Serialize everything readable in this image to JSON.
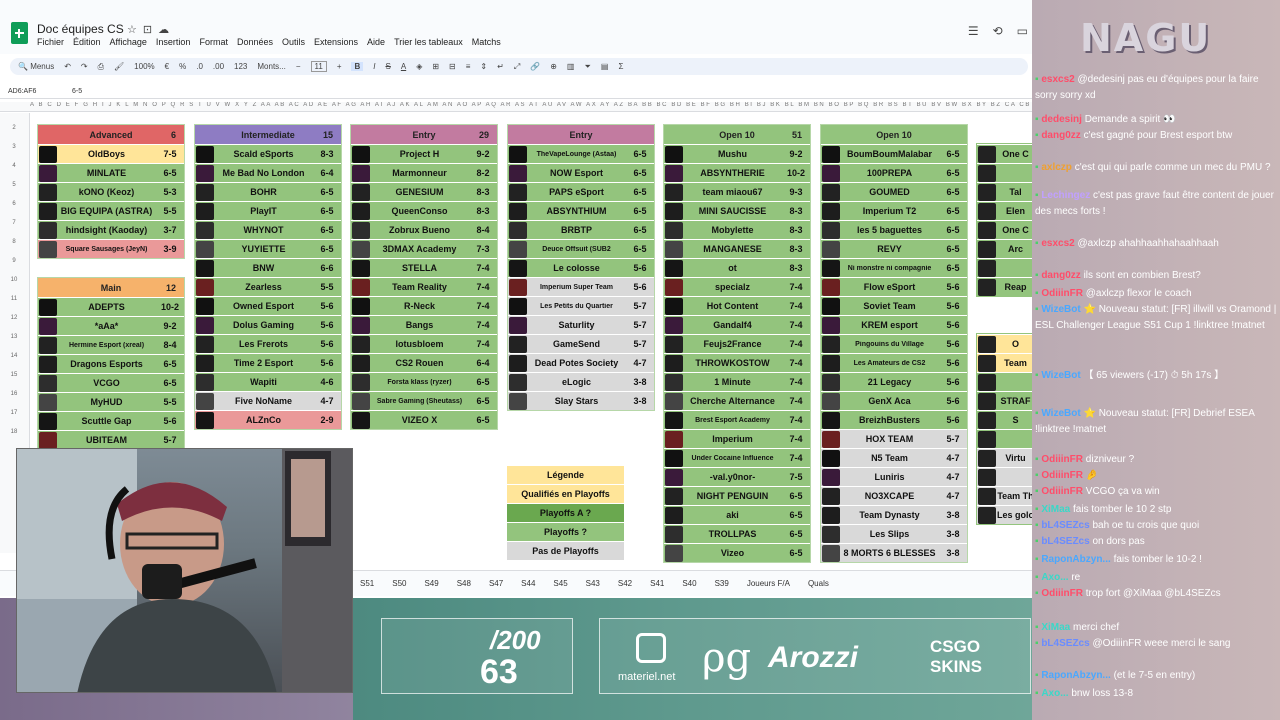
{
  "doc": {
    "title": "Doc équipes CS",
    "menus": [
      "Fichier",
      "Édition",
      "Affichage",
      "Insertion",
      "Format",
      "Données",
      "Outils",
      "Extensions",
      "Aide",
      "Trier les tableaux",
      "Matchs"
    ]
  },
  "toolbar": {
    "menus_label": "Menus",
    "zoom": "100%",
    "euro": "€",
    "percent": "%",
    "dec_dec": ".0",
    "dec_inc": ".00",
    "numfmt": "123",
    "font": "Monts...",
    "font_size": "11",
    "bold": "B",
    "italic": "I",
    "strike": "S",
    "underline": "A"
  },
  "formula": {
    "ref": "AD6:AF6",
    "value": "6-5"
  },
  "col_headers": "A B C D E F G H I J K L M N O P Q R S T U V W X Y Z AA AB AC AD AE AF AG AH AI AJ AK AL AM AN AO AP AQ AR AS AT AU AV AW AX AY AZ BA BB BC BD BE BF BG BH BI BJ BK BL BM BN BO BP BQ BR BS BT BU BV BW BX BY BZ CA CB CC CD CE CF CG CH CI CJ CK CL CM CN CO CP CQ CR CS CT CU CV CW CX CY",
  "row_numbers": [
    "2",
    "3",
    "4",
    "5",
    "6",
    "7",
    "8",
    "9",
    "10",
    "11",
    "12",
    "13",
    "14",
    "15",
    "16",
    "17",
    "18"
  ],
  "groups": [
    {
      "name": "Advanced",
      "count": "6",
      "color": "#e06666",
      "rows": [
        {
          "team": "OldBoys",
          "score": "7-5",
          "bg": "#ffe599"
        },
        {
          "team": "MINLATE",
          "score": "6-5",
          "bg": "#93c47d"
        },
        {
          "team": "kONO (Keoz)",
          "score": "5-3",
          "bg": "#93c47d"
        },
        {
          "team": "BIG EQUIPA (ASTRA)",
          "score": "5-5",
          "bg": "#93c47d"
        },
        {
          "team": "hindsight (Kaoday)",
          "score": "3-7",
          "bg": "#93c47d"
        },
        {
          "team": "Square Sausages (JeyN)",
          "score": "3-9",
          "bg": "#ea9999"
        }
      ]
    },
    {
      "name": "Intermediate",
      "count": "15",
      "color": "#8e7cc3",
      "rows": [
        {
          "team": "Scald eSports",
          "score": "8-3",
          "bg": "#93c47d"
        },
        {
          "team": "Me Bad No London",
          "score": "6-4",
          "bg": "#93c47d"
        },
        {
          "team": "BOHR",
          "score": "6-5",
          "bg": "#93c47d"
        },
        {
          "team": "PlayIT",
          "score": "6-5",
          "bg": "#93c47d"
        },
        {
          "team": "WHYNOT",
          "score": "6-5",
          "bg": "#93c47d"
        },
        {
          "team": "YUYIETTE",
          "score": "6-5",
          "bg": "#93c47d"
        },
        {
          "team": "BNW",
          "score": "6-6",
          "bg": "#93c47d"
        },
        {
          "team": "Zearless",
          "score": "5-5",
          "bg": "#93c47d"
        },
        {
          "team": "Owned Esport",
          "score": "5-6",
          "bg": "#93c47d"
        },
        {
          "team": "Dolus Gaming",
          "score": "5-6",
          "bg": "#93c47d"
        },
        {
          "team": "Les Frerots",
          "score": "5-6",
          "bg": "#93c47d"
        },
        {
          "team": "Time 2 Esport",
          "score": "5-6",
          "bg": "#93c47d"
        },
        {
          "team": "Wapiti",
          "score": "4-6",
          "bg": "#93c47d"
        },
        {
          "team": "Five NoName",
          "score": "4-7",
          "bg": "#d9d9d9"
        },
        {
          "team": "ALZnCo",
          "score": "2-9",
          "bg": "#ea9999"
        }
      ]
    },
    {
      "name": "Entry",
      "count": "29",
      "color": "#c27ba0",
      "rows": [
        {
          "team": "Project H",
          "score": "9-2",
          "bg": "#93c47d"
        },
        {
          "team": "Marmonneur",
          "score": "8-2",
          "bg": "#93c47d"
        },
        {
          "team": "GENESIUM",
          "score": "8-3",
          "bg": "#93c47d"
        },
        {
          "team": "QueenConso",
          "score": "8-3",
          "bg": "#93c47d"
        },
        {
          "team": "Zobrux Bueno",
          "score": "8-4",
          "bg": "#93c47d"
        },
        {
          "team": "3DMAX Academy",
          "score": "7-3",
          "bg": "#93c47d"
        },
        {
          "team": "STELLA",
          "score": "7-4",
          "bg": "#93c47d"
        },
        {
          "team": "Team Reality",
          "score": "7-4",
          "bg": "#93c47d"
        },
        {
          "team": "R-Neck",
          "score": "7-4",
          "bg": "#93c47d"
        },
        {
          "team": "Bangs",
          "score": "7-4",
          "bg": "#93c47d"
        },
        {
          "team": "lotusbloem",
          "score": "7-4",
          "bg": "#93c47d"
        },
        {
          "team": "CS2 Rouen",
          "score": "6-4",
          "bg": "#93c47d"
        },
        {
          "team": "Forsta klass (ryzer)",
          "score": "6-5",
          "bg": "#93c47d"
        },
        {
          "team": "Sabre Gaming (Sheutass)",
          "score": "6-5",
          "bg": "#93c47d"
        },
        {
          "team": "VIZEO X",
          "score": "6-5",
          "bg": "#93c47d"
        }
      ]
    },
    {
      "name": "Entry",
      "count": "",
      "color": "#c27ba0",
      "rows": [
        {
          "team": "TheVapeLounge (Astaa)",
          "score": "6-5",
          "bg": "#93c47d"
        },
        {
          "team": "NOW Esport",
          "score": "6-5",
          "bg": "#93c47d"
        },
        {
          "team": "PAPS eSport",
          "score": "6-5",
          "bg": "#93c47d"
        },
        {
          "team": "ABSYNTHIUM",
          "score": "6-5",
          "bg": "#93c47d"
        },
        {
          "team": "BRBTP",
          "score": "6-5",
          "bg": "#93c47d"
        },
        {
          "team": "Deuce Offsuit (SUB2",
          "score": "6-5",
          "bg": "#93c47d"
        },
        {
          "team": "Le colosse",
          "score": "5-6",
          "bg": "#93c47d"
        },
        {
          "team": "Imperium Super Team",
          "score": "5-6",
          "bg": "#d9d9d9"
        },
        {
          "team": "Les Petits du Quartier",
          "score": "5-7",
          "bg": "#d9d9d9"
        },
        {
          "team": "Saturlity",
          "score": "5-7",
          "bg": "#d9d9d9"
        },
        {
          "team": "GameSend",
          "score": "5-7",
          "bg": "#d9d9d9"
        },
        {
          "team": "Dead Potes Society",
          "score": "4-7",
          "bg": "#d9d9d9"
        },
        {
          "team": "eLogic",
          "score": "3-8",
          "bg": "#d9d9d9"
        },
        {
          "team": "Slay Stars",
          "score": "3-8",
          "bg": "#d9d9d9"
        }
      ]
    },
    {
      "name": "Open 10",
      "count": "51",
      "color": "#93c47d",
      "rows": [
        {
          "team": "Mushu",
          "score": "9-2",
          "bg": "#93c47d"
        },
        {
          "team": "ABSYNTHERIE",
          "score": "10-2",
          "bg": "#93c47d"
        },
        {
          "team": "team miaou67",
          "score": "9-3",
          "bg": "#93c47d"
        },
        {
          "team": "MINI SAUCISSE",
          "score": "8-3",
          "bg": "#93c47d"
        },
        {
          "team": "Mobylette",
          "score": "8-3",
          "bg": "#93c47d"
        },
        {
          "team": "MANGANESE",
          "score": "8-3",
          "bg": "#93c47d"
        },
        {
          "team": "ot",
          "score": "8-3",
          "bg": "#93c47d"
        },
        {
          "team": "specialz",
          "score": "7-4",
          "bg": "#93c47d"
        },
        {
          "team": "Hot Content",
          "score": "7-4",
          "bg": "#93c47d"
        },
        {
          "team": "Gandalf4",
          "score": "7-4",
          "bg": "#93c47d"
        },
        {
          "team": "Feujs2France",
          "score": "7-4",
          "bg": "#93c47d"
        },
        {
          "team": "THROWKOSTOW",
          "score": "7-4",
          "bg": "#93c47d"
        },
        {
          "team": "1 Minute",
          "score": "7-4",
          "bg": "#93c47d"
        },
        {
          "team": "Cherche Alternance",
          "score": "7-4",
          "bg": "#93c47d"
        },
        {
          "team": "Brest Esport Academy",
          "score": "7-4",
          "bg": "#93c47d"
        },
        {
          "team": "Imperium",
          "score": "7-4",
          "bg": "#93c47d"
        },
        {
          "team": "Under Cocaine Influence",
          "score": "7-4",
          "bg": "#93c47d"
        },
        {
          "team": "-val.y0nor-",
          "score": "7-5",
          "bg": "#93c47d"
        },
        {
          "team": "NIGHT PENGUIN",
          "score": "6-5",
          "bg": "#93c47d"
        },
        {
          "team": "aki",
          "score": "6-5",
          "bg": "#93c47d"
        },
        {
          "team": "TROLLPAS",
          "score": "6-5",
          "bg": "#93c47d"
        },
        {
          "team": "Vizeo",
          "score": "6-5",
          "bg": "#93c47d"
        }
      ]
    },
    {
      "name": "Open 10",
      "count": "",
      "color": "#93c47d",
      "rows": [
        {
          "team": "BoumBoumMalabar",
          "score": "6-5",
          "bg": "#93c47d"
        },
        {
          "team": "100PREPA",
          "score": "6-5",
          "bg": "#93c47d"
        },
        {
          "team": "GOUMED",
          "score": "6-5",
          "bg": "#93c47d"
        },
        {
          "team": "Imperium T2",
          "score": "6-5",
          "bg": "#93c47d"
        },
        {
          "team": "les 5 baguettes",
          "score": "6-5",
          "bg": "#93c47d"
        },
        {
          "team": "REVY",
          "score": "6-5",
          "bg": "#93c47d"
        },
        {
          "team": "Ni monstre ni compagnie",
          "score": "6-5",
          "bg": "#93c47d"
        },
        {
          "team": "Flow eSport",
          "score": "5-6",
          "bg": "#93c47d"
        },
        {
          "team": "Soviet Team",
          "score": "5-6",
          "bg": "#93c47d"
        },
        {
          "team": "KREM esport",
          "score": "5-6",
          "bg": "#93c47d"
        },
        {
          "team": "Pingouins du Village",
          "score": "5-6",
          "bg": "#93c47d"
        },
        {
          "team": "Les Amateurs de CS2",
          "score": "5-6",
          "bg": "#93c47d"
        },
        {
          "team": "21 Legacy",
          "score": "5-6",
          "bg": "#93c47d"
        },
        {
          "team": "GenX Aca",
          "score": "5-6",
          "bg": "#93c47d"
        },
        {
          "team": "BreizhBusters",
          "score": "5-6",
          "bg": "#93c47d"
        },
        {
          "team": "HOX TEAM",
          "score": "5-7",
          "bg": "#d9d9d9"
        },
        {
          "team": "N5 Team",
          "score": "4-7",
          "bg": "#d9d9d9"
        },
        {
          "team": "Luniris",
          "score": "4-7",
          "bg": "#d9d9d9"
        },
        {
          "team": "NO3XCAPE",
          "score": "4-7",
          "bg": "#d9d9d9"
        },
        {
          "team": "Team Dynasty",
          "score": "3-8",
          "bg": "#d9d9d9"
        },
        {
          "team": "Les Slips",
          "score": "3-8",
          "bg": "#d9d9d9"
        },
        {
          "team": "8 MORTS 6 BLESSES",
          "score": "3-8",
          "bg": "#d9d9d9"
        }
      ]
    }
  ],
  "main_group": {
    "name": "Main",
    "count": "12",
    "color": "#f6b26b",
    "rows": [
      {
        "team": "ADEPTS",
        "score": "10-2",
        "bg": "#93c47d"
      },
      {
        "team": "*aAa*",
        "score": "9-2",
        "bg": "#93c47d"
      },
      {
        "team": "Hermine Esport (xreal)",
        "score": "8-4",
        "bg": "#93c47d"
      },
      {
        "team": "Dragons Esports",
        "score": "6-5",
        "bg": "#93c47d"
      },
      {
        "team": "VCGO",
        "score": "6-5",
        "bg": "#93c47d"
      },
      {
        "team": "MyHUD",
        "score": "5-5",
        "bg": "#93c47d"
      },
      {
        "team": "Scuttle Gap",
        "score": "5-6",
        "bg": "#93c47d"
      },
      {
        "team": "UBITEAM",
        "score": "5-7",
        "bg": "#93c47d"
      }
    ]
  },
  "partial_col": {
    "rows": [
      "One C",
      "",
      "Tal",
      "Elen",
      "One C",
      "Arc",
      "",
      "Reap"
    ]
  },
  "partial_col2": {
    "rows": [
      "O",
      "Team",
      "",
      "STRAF",
      "S",
      "",
      "Virtu",
      "",
      "Team Th",
      "Les golo"
    ]
  },
  "legend": {
    "title": "Légende",
    "items": [
      {
        "label": "Qualifiés en Playoffs",
        "bg": "#ffe599"
      },
      {
        "label": "Playoffs A ?",
        "bg": "#6aa84f"
      },
      {
        "label": "Playoffs ?",
        "bg": "#93c47d"
      },
      {
        "label": "Pas de Playoffs",
        "bg": "#d9d9d9"
      }
    ]
  },
  "tabs": [
    "S51",
    "S50",
    "S49",
    "S48",
    "S47",
    "S44",
    "S45",
    "S43",
    "S42",
    "S41",
    "S40",
    "S39",
    "Joueurs F/A",
    "Quals"
  ],
  "brand": "NAGU",
  "sponsor": {
    "sub_count": "/200",
    "sub_value": "63",
    "s1": "materiel.net",
    "s2": "Arozzi",
    "s3": "CSGO SKINS"
  },
  "chat": [
    {
      "user": "esxcs2",
      "color": "#ff4d6a",
      "text": "@dedesinj pas eu d'équipes pour la faire sorry sorry xd"
    },
    {
      "user": "dedesinj",
      "color": "#ff4d6a",
      "text": "Demande a spirit 👀"
    },
    {
      "user": "dang0zz",
      "color": "#ff4d6a",
      "text": "c'est gagné pour Brest esport btw"
    },
    {
      "user": "axlczp",
      "color": "#f0a030",
      "text": "c'est qui qui parle comme un mec du PMU ?"
    },
    {
      "user": "Lechingez",
      "color": "#c0a0ff",
      "text": "c'est pas grave faut être content de jouer des mecs forts !"
    },
    {
      "user": "esxcs2",
      "color": "#ff4d6a",
      "text": "@axlczp ahahhaahhahaahhaah"
    },
    {
      "user": "dang0zz",
      "color": "#ff4d6a",
      "text": "ils sont en combien Brest?"
    },
    {
      "user": "OdiiinFR",
      "color": "#ff4d6a",
      "text": "@axlczp flexor le coach"
    },
    {
      "user": "WizeBot",
      "color": "#4aa8ff",
      "text": "⭐ Nouveau statut: [FR] illwill vs Oramond | ESL Challenger League S51 Cup 1 !linktree !matnet"
    },
    {
      "user": "WizeBot",
      "color": "#4aa8ff",
      "text": "【 65 viewers (-17) ⏱ 5h 17s 】"
    },
    {
      "user": "WizeBot",
      "color": "#4aa8ff",
      "text": "⭐ Nouveau statut: [FR] Debrief ESEA !linktree !matnet"
    },
    {
      "user": "OdiiinFR",
      "color": "#ff4d6a",
      "text": "dizniveur ?"
    },
    {
      "user": "OdiiinFR",
      "color": "#ff4d6a",
      "text": "🤌"
    },
    {
      "user": "OdiiinFR",
      "color": "#ff4d6a",
      "text": "VCGO ça va win"
    },
    {
      "user": "XiMaa",
      "color": "#3ad8c8",
      "text": "fais tomber le 10 2 stp"
    },
    {
      "user": "bL4SEZcs",
      "color": "#6a8cff",
      "text": "bah oe tu crois que quoi"
    },
    {
      "user": "bL4SEZcs",
      "color": "#6a8cff",
      "text": "on dors pas"
    },
    {
      "user": "RaponAbzyn...",
      "color": "#4aa8ff",
      "text": "fais tomber le 10-2 !"
    },
    {
      "user": "Axo...",
      "color": "#3ad8c8",
      "text": "re"
    },
    {
      "user": "OdiiinFR",
      "color": "#ff4d6a",
      "text": "trop fort @XiMaa @bL4SEZcs"
    },
    {
      "user": "XiMaa",
      "color": "#3ad8c8",
      "text": "merci chef"
    },
    {
      "user": "bL4SEZcs",
      "color": "#6a8cff",
      "text": "@OdiiinFR weee merci le sang"
    },
    {
      "user": "RaponAbzyn...",
      "color": "#4aa8ff",
      "text": "(et le 7-5 en entry)"
    },
    {
      "user": "Axo...",
      "color": "#3ad8c8",
      "text": "bnw loss 13-8"
    }
  ]
}
